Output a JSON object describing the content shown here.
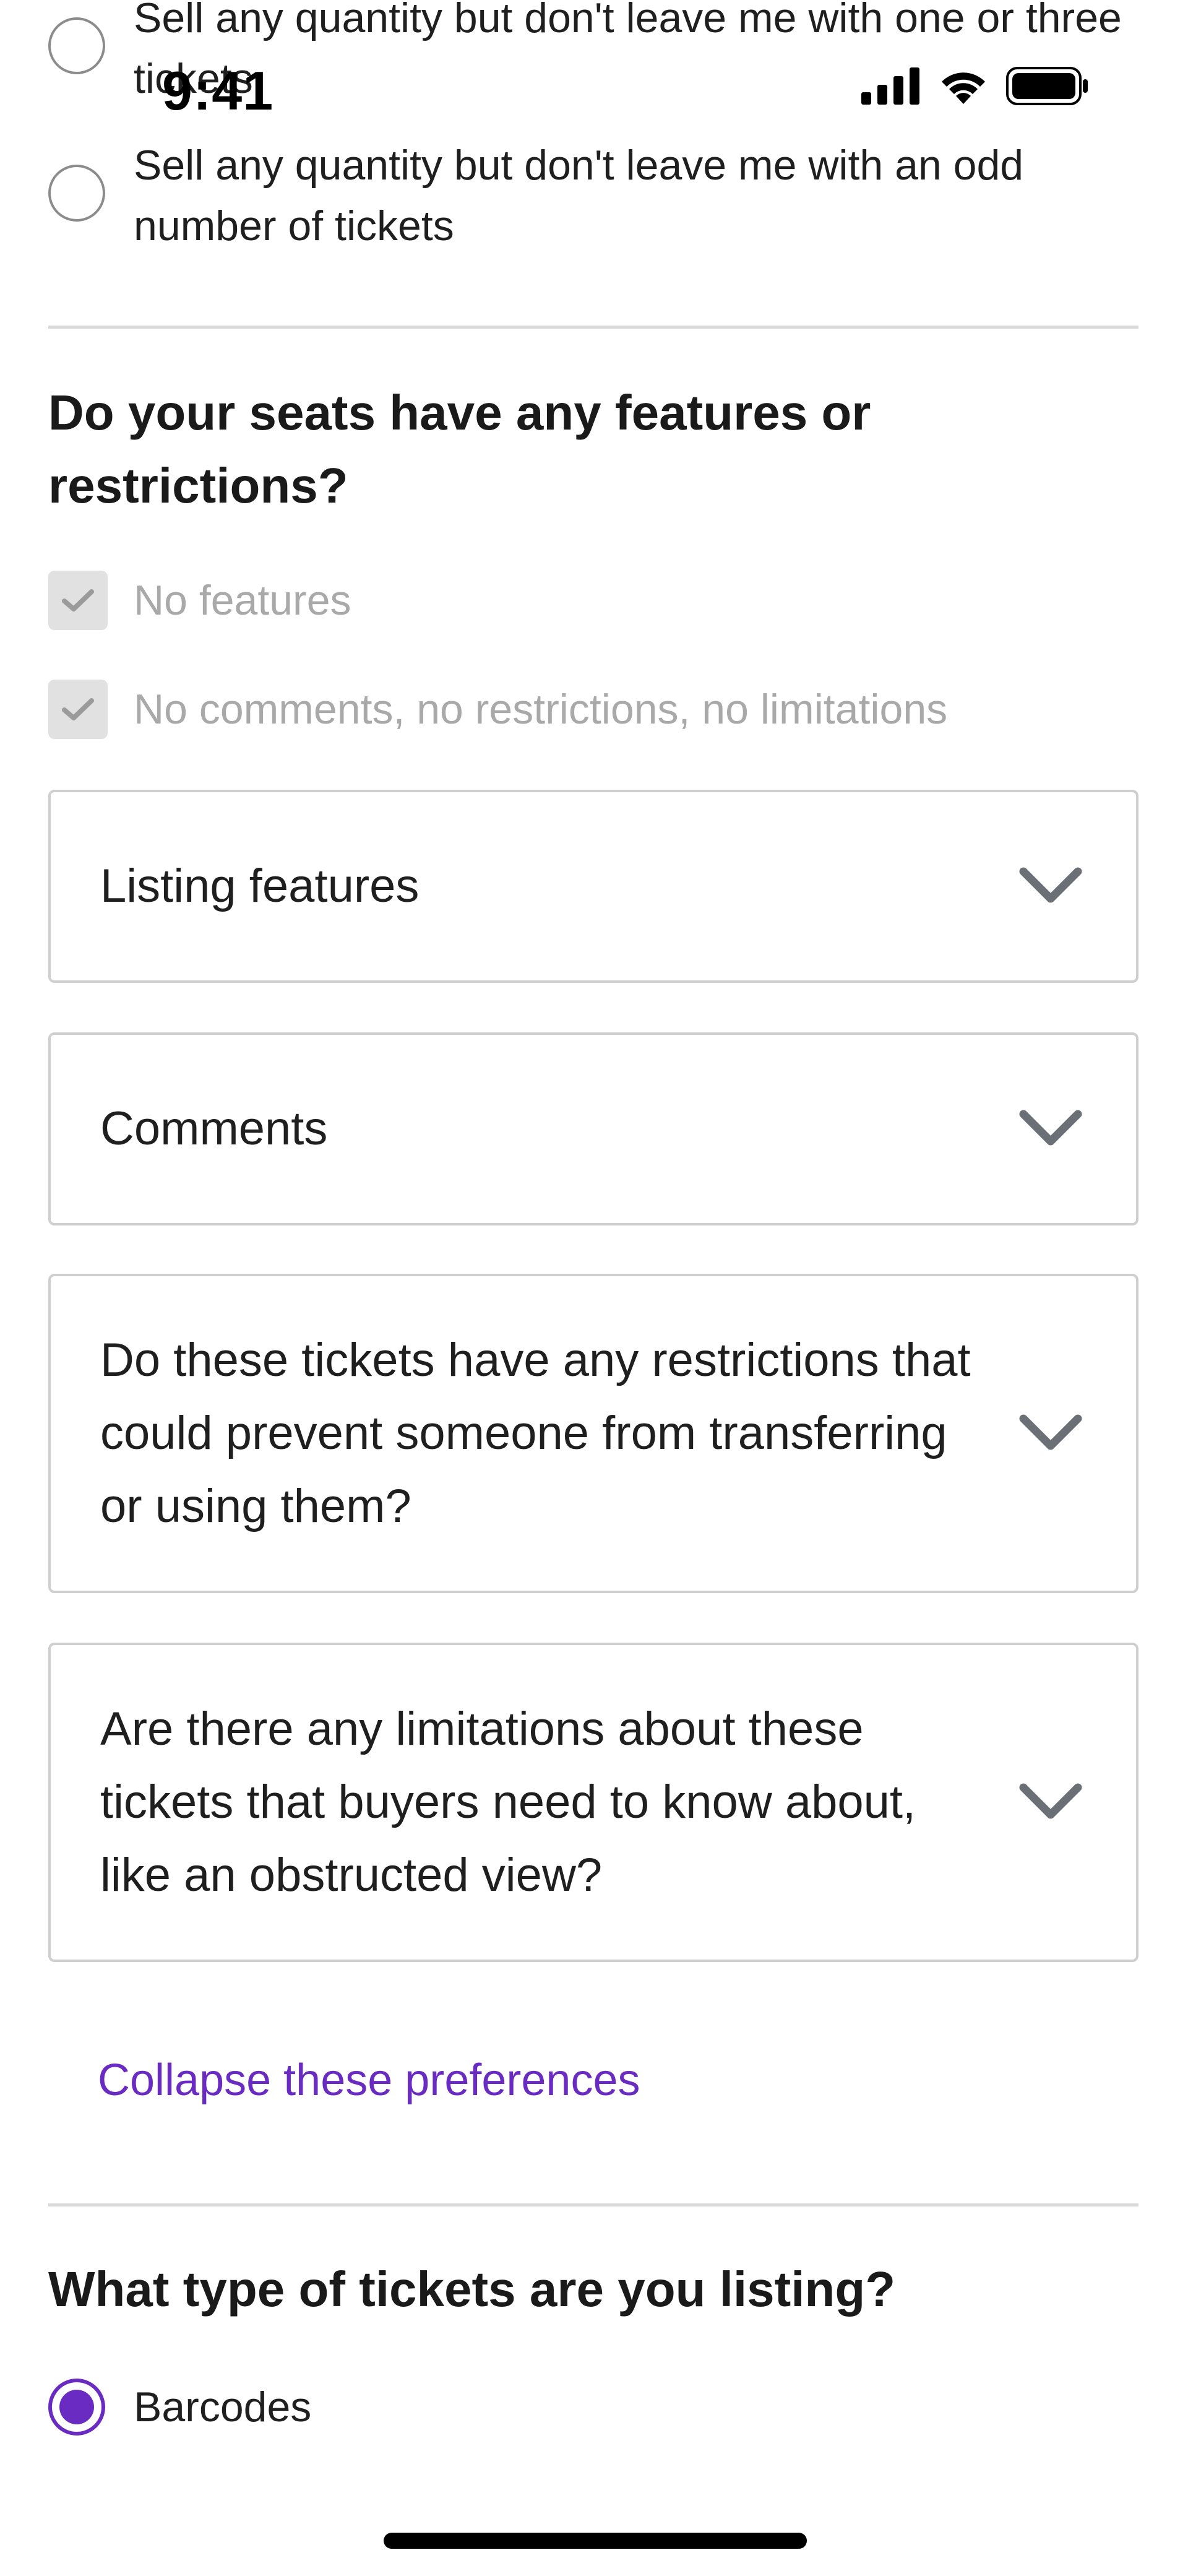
{
  "status_bar": {
    "time": "9:41"
  },
  "quantity_options": [
    {
      "label": "Sell any quantity but don't leave me with one or three tickets",
      "selected": false
    },
    {
      "label": "Sell any quantity but don't leave me with an odd number of tickets",
      "selected": false
    }
  ],
  "features_section": {
    "heading": "Do your seats have any features or restrictions?",
    "checkboxes": [
      {
        "label": "No features",
        "checked": true,
        "disabled": true
      },
      {
        "label": "No comments, no restrictions, no limitations",
        "checked": true,
        "disabled": true
      }
    ],
    "accordions": [
      {
        "label": "Listing features"
      },
      {
        "label": "Comments"
      },
      {
        "label": "Do these tickets have any restrictions that could prevent someone from transferring or using them?"
      },
      {
        "label": "Are there any limitations about these tickets that buyers need to know about, like an obstructed view?"
      }
    ],
    "collapse_link": "Collapse these preferences"
  },
  "ticket_type_section": {
    "heading": "What type of tickets are you listing?",
    "options": [
      {
        "label": "Barcodes",
        "selected": true
      }
    ]
  },
  "colors": {
    "accent": "#6a2bc2",
    "divider": "#d9d9d9",
    "disabled_text": "#a9a9a9",
    "border": "#cfcfcf"
  }
}
